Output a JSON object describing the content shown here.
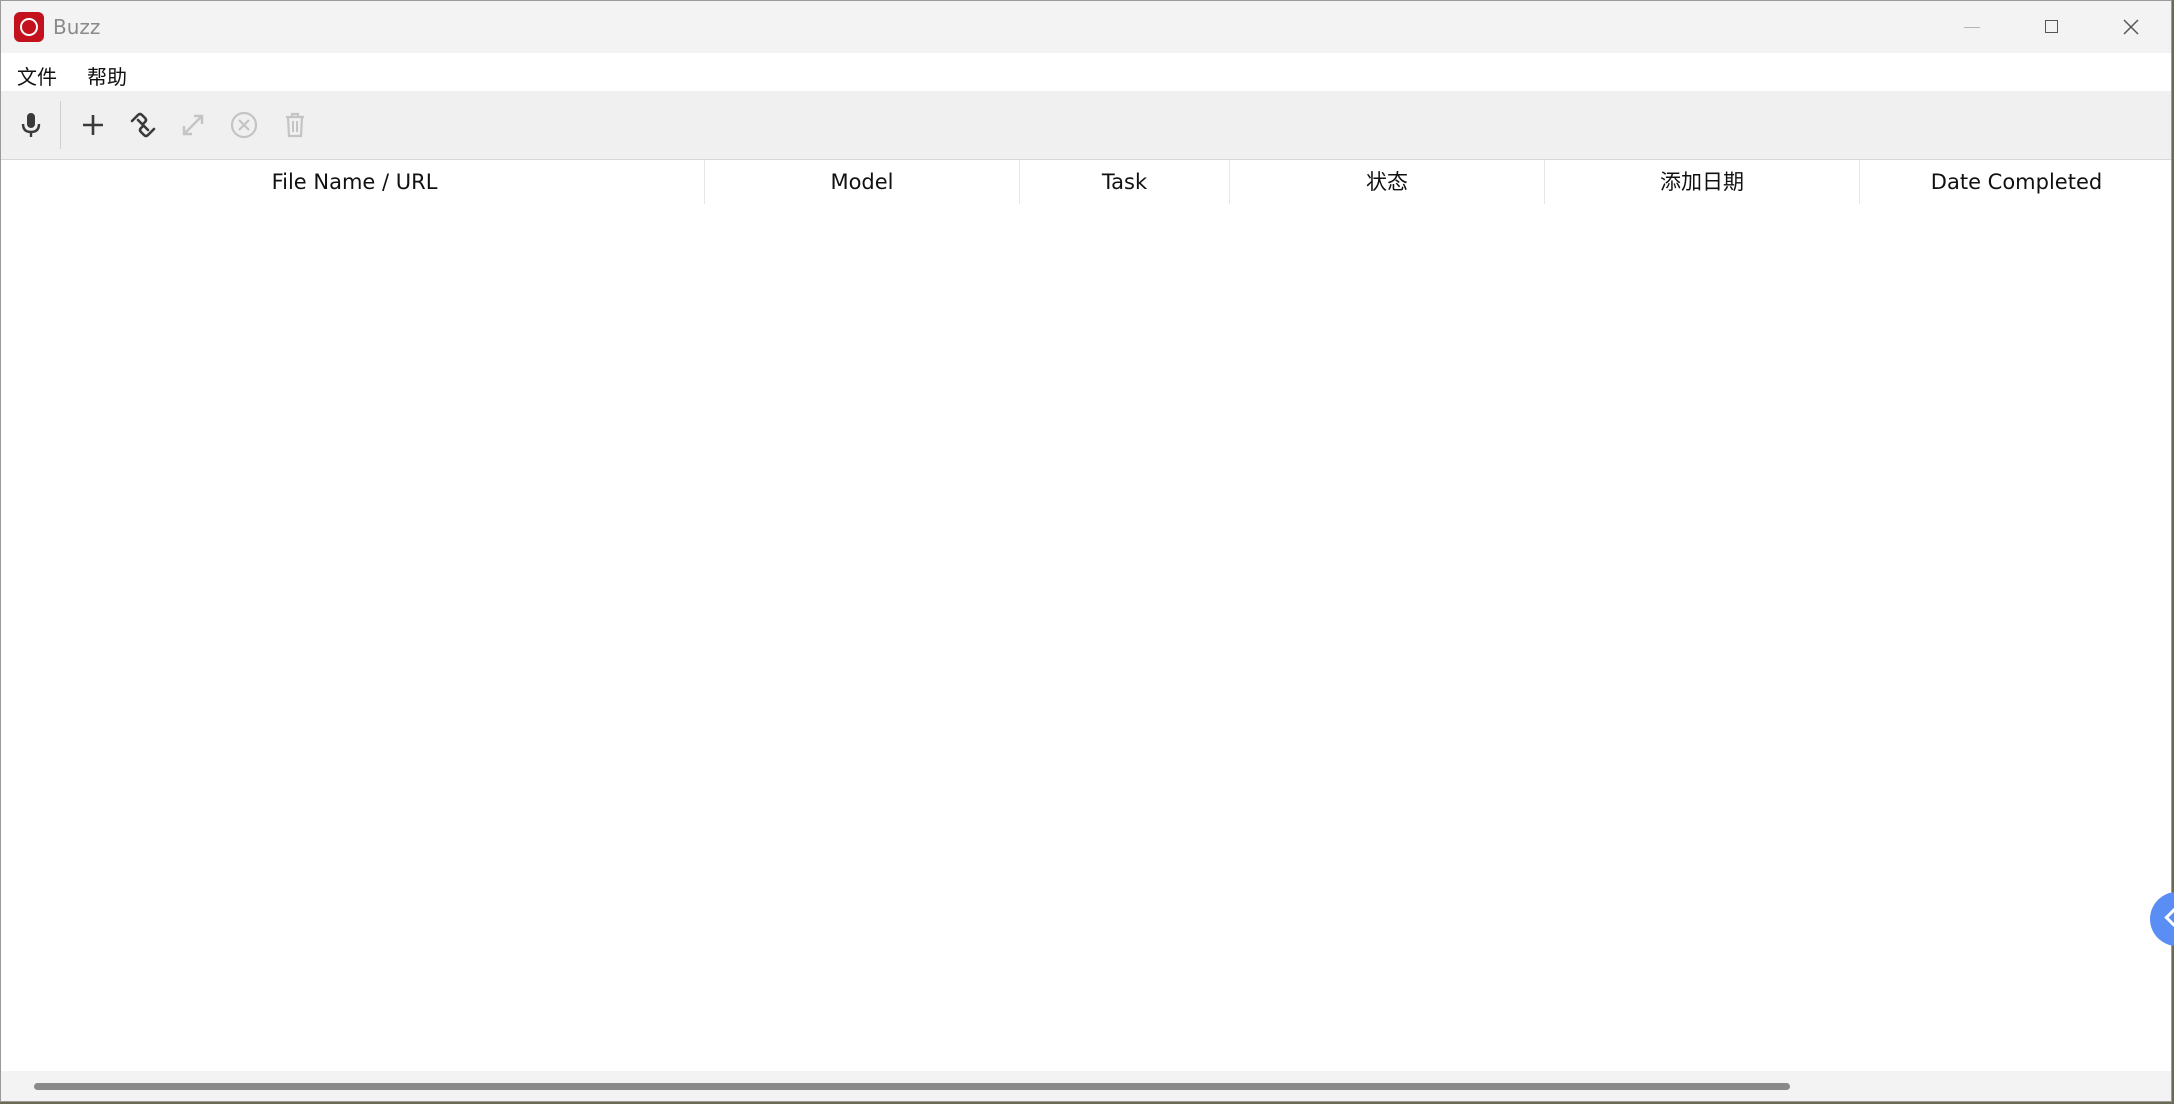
{
  "window": {
    "title": "Buzz"
  },
  "menu": {
    "items": [
      {
        "label": "文件"
      },
      {
        "label": "帮助"
      }
    ]
  },
  "toolbar": {
    "buttons": [
      {
        "icon": "microphone-icon",
        "enabled": true
      },
      {
        "icon": "plus-icon",
        "enabled": true
      },
      {
        "icon": "link-icon",
        "enabled": true
      },
      {
        "icon": "expand-icon",
        "enabled": false
      },
      {
        "icon": "cancel-circle-icon",
        "enabled": false
      },
      {
        "icon": "trash-icon",
        "enabled": false
      }
    ]
  },
  "table": {
    "columns": [
      {
        "label": "File Name / URL"
      },
      {
        "label": "Model"
      },
      {
        "label": "Task"
      },
      {
        "label": "状态"
      },
      {
        "label": "添加日期"
      },
      {
        "label": "Date Completed"
      }
    ],
    "rows": []
  },
  "colors": {
    "accent": "#c3111d",
    "toolbar_bg": "#f0f0f0",
    "icon_active": "#3a3a3a",
    "icon_disabled": "#c4c4c4",
    "side_widget": "#5b8ef5"
  }
}
